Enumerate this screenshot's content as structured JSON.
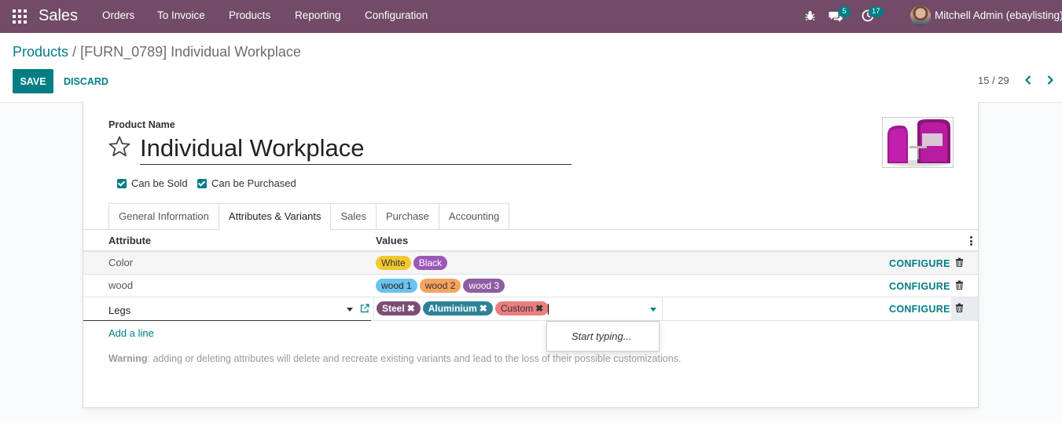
{
  "app": {
    "brand": "Sales",
    "menu": [
      "Orders",
      "To Invoice",
      "Products",
      "Reporting",
      "Configuration"
    ],
    "messages_count": "5",
    "activities_count": "17",
    "user_name": "Mitchell Admin (ebaylisting)"
  },
  "breadcrumb": {
    "parent": "Products",
    "separator": "/",
    "current": "[FURN_0789] Individual Workplace"
  },
  "actions": {
    "save_label": "SAVE",
    "discard_label": "DISCARD"
  },
  "pager": {
    "value": "15 / 29"
  },
  "form": {
    "product_name_label": "Product Name",
    "product_name": "Individual Workplace",
    "can_be_sold_label": "Can be Sold",
    "can_be_purchased_label": "Can be Purchased",
    "can_be_sold": true,
    "can_be_purchased": true,
    "tabs": [
      "General Information",
      "Attributes & Variants",
      "Sales",
      "Purchase",
      "Accounting"
    ],
    "active_tab": "Attributes & Variants"
  },
  "attributes": {
    "headers": {
      "attribute": "Attribute",
      "values": "Values"
    },
    "configure_label": "CONFIGURE",
    "rows": [
      {
        "attribute": "Color",
        "values": [
          "White",
          "Black"
        ]
      },
      {
        "attribute": "wood",
        "values": [
          "wood 1",
          "wood 2",
          "wood 3"
        ]
      },
      {
        "attribute": "Legs",
        "values": [
          "Steel",
          "Aluminium",
          "Custom"
        ]
      }
    ],
    "add_line_label": "Add a line",
    "warning_label": "Warning",
    "warning_text": ": adding or deleting attributes will delete and recreate existing variants and lead to the loss of their possible customizations."
  },
  "dropdown": {
    "hint": "Start typing..."
  },
  "colors": {
    "navbar": "#714b67",
    "accent": "#017e84"
  }
}
